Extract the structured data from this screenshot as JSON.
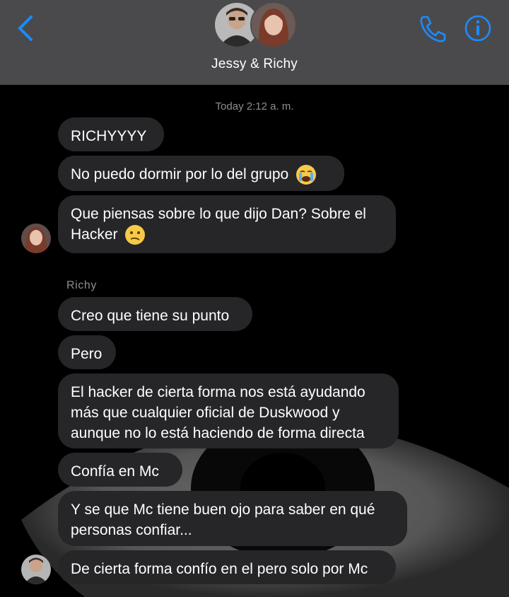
{
  "header": {
    "title": "Jessy & Richy",
    "back_icon": "chevron-left-icon",
    "call_icon": "phone-icon",
    "info_icon": "info-icon",
    "accent_color": "#1a8cff"
  },
  "conversation": {
    "timestamp": "Today 2:12 a. m.",
    "groups": [
      {
        "sender": "Jessy",
        "show_name": false,
        "messages": [
          "RICHYYYY",
          "No puedo dormir por lo del grupo",
          "Que piensas sobre lo que dijo Dan? Sobre el",
          "Hacker"
        ]
      },
      {
        "sender": "Richy",
        "show_name": true,
        "messages": [
          "Creo que tiene su punto",
          "Pero",
          "El hacker de cierta forma nos está ayudando",
          "más que cualquier oficial de Duskwood y",
          "aunque no lo está haciendo de forma directa",
          "Confía en Mc",
          "Y se que Mc tiene buen ojo para saber en qué",
          "personas confiar...",
          "De cierta forma confío en el pero solo por Mc"
        ]
      }
    ]
  },
  "colors": {
    "header_bg": "#4a4a4c",
    "bubble_bg": "#262628",
    "meta_text": "#8e8e93"
  }
}
